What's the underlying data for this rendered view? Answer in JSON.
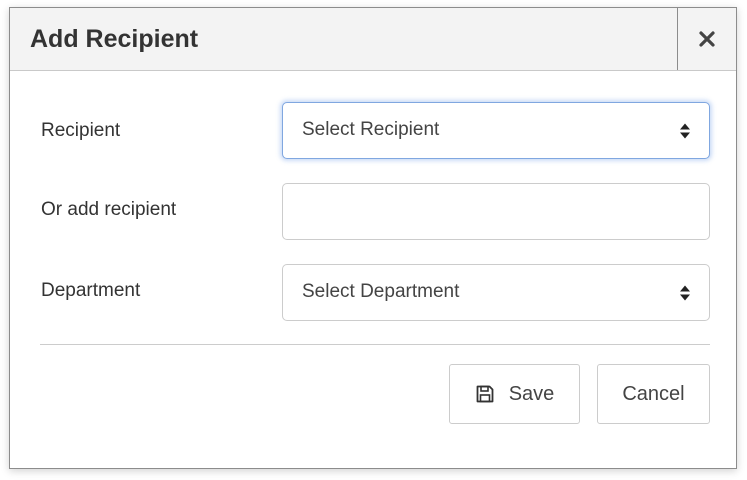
{
  "dialog": {
    "title": "Add Recipient"
  },
  "form": {
    "recipient": {
      "label": "Recipient",
      "selected": "Select Recipient"
    },
    "new_recipient": {
      "label": "Or add recipient",
      "value": ""
    },
    "department": {
      "label": "Department",
      "selected": "Select Department"
    }
  },
  "footer": {
    "save_label": "Save",
    "cancel_label": "Cancel"
  },
  "icons": {
    "close": "close-icon",
    "sort": "sort-icon",
    "save": "floppy-disk-icon"
  },
  "colors": {
    "header_bg": "#f3f3f3",
    "focus_border": "#80a7e0",
    "text": "#333333"
  }
}
